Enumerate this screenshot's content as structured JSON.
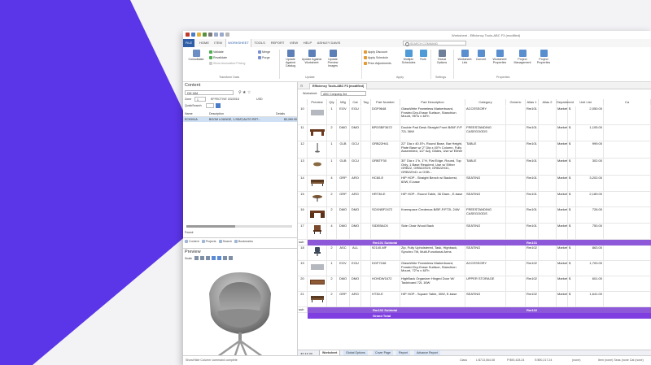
{
  "app": {
    "title": "Worksheet - Efficiency Tools-ABC F3 (modified)"
  },
  "menu": {
    "items": [
      "FILE",
      "HOME",
      "ITEM",
      "WORKSHEET",
      "TOOLS",
      "REPORT",
      "VIEW",
      "HELP",
      "ASHLEY DAVIS"
    ],
    "active": "WORKSHEET",
    "search_placeholder": "SEARCH COMMAND"
  },
  "ribbon": {
    "consolidate": "Consolidate",
    "validate": "Validate",
    "revalidate": "Revalidate",
    "show_associated": "Show Associated Pricing",
    "merge": "Merge",
    "purge": "Purge",
    "group_transform": "Transform Data",
    "update_catalog": "Update Against Catalog",
    "update_worksheet": "Update Against Worksheet",
    "update_preview": "Update Preview Images",
    "group_update": "Update",
    "apply_discount": "Apply Discount",
    "apply_schedule": "Apply Schedule",
    "price_adjustments": "Price Adjustments",
    "multiple_schedules": "Multiple Schedules",
    "rule": "Rule",
    "group_apply": "Apply",
    "global_options": "Global Options",
    "group_settings": "Settings",
    "worksheet_link": "Worksheet Link",
    "convert": "Convert",
    "worksheet_properties": "Worksheet Properties",
    "project_management": "Project Management",
    "project_properties": "Project Properties",
    "group_properties": "Properties"
  },
  "content_panel": {
    "title": "Content",
    "catalog_select": "DM 16M",
    "zone_label": "Zone",
    "zone_value": "1",
    "effective": "EFFECTIVE 3/3/2016",
    "currency": "USD",
    "quicksearch_label": "QuickSearch",
    "columns": [
      "Name",
      "Description",
      "Details"
    ],
    "row": {
      "name": "ECK991A",
      "description": "BOOM LOUNGE, 1-SEAT,AUTO RET...",
      "details": "$3,260.00"
    },
    "found_label": "Found:",
    "tabs": [
      "Content",
      "Projects",
      "Search",
      "Bookmarks"
    ]
  },
  "preview_panel": {
    "title": "Preview",
    "scale_label": "Scale"
  },
  "document": {
    "tab_title": "Efficiency Tools-ABC F3 (modified)",
    "worksheet_label": "Worksheet:",
    "worksheet_value": "ABC Company 3rd"
  },
  "grid": {
    "columns": [
      "Preview",
      "Qty",
      "Mfg",
      "Cat",
      "Tag",
      "Part Number",
      "Part Description",
      "Category",
      "Generic",
      "Alias 1",
      "Alias 2",
      "Department",
      "Unit List",
      "Ca"
    ],
    "rows": [
      {
        "num": "10",
        "qty": "1",
        "mfg": "EGV",
        "cat": "EGU",
        "part": "DGF9648",
        "desc": "GlassWrite Frameless Markerboard, Frosted Dry-Erase Surface, Stanchion Mount, 96\"w x 48\"h",
        "category": "ACCESSORY",
        "alias1": "Rm101",
        "dept": "Marketing",
        "currency": "$",
        "price": "2,050.00",
        "thumb": "board"
      },
      {
        "num": "11",
        "qty": "2",
        "mfg": "DMO",
        "cat": "DMO",
        "part": "BPDSBF3672",
        "desc": "Double Pad Desk Straight Front B/B/F-F/F 72L 36W",
        "category": "FREESTANDING CASEGOODS",
        "alias1": "Rm101",
        "dept": "Marketing",
        "currency": "$",
        "price": "1,105.00",
        "thumb": "desk"
      },
      {
        "num": "12",
        "qty": "1",
        "mfg": "GLB",
        "cat": "GCU",
        "part": "GRB22H41",
        "desc": "22\" Dia x 40.5\"h, Round Base, Bar Height, Plate Base w/ 2\" Dia x 40\"h Column, Fully Assembled, 1/2\" Adj. Glides, Use w/ Either",
        "category": "TABLE",
        "alias1": "Rm101",
        "dept": "Marketing",
        "currency": "$",
        "price": "999.00",
        "thumb": "column"
      },
      {
        "num": "13",
        "qty": "1",
        "mfg": "GLB",
        "cat": "GCU",
        "part": "GRBTF30",
        "desc": "30\" Dia x 1\"h, 1\"H, Flat Edge, Round, Top Only, 1 Base Required, Use w/ Either GRB22, GRB22H29, GRB22H31, GRB22H41 or GSB...",
        "category": "TABLE",
        "alias1": "Rm101",
        "dept": "Marketing",
        "currency": "$",
        "price": "302.00",
        "thumb": "top"
      },
      {
        "num": "14",
        "qty": "4",
        "mfg": "GRP",
        "cat": "ARO",
        "part": "HC60-E",
        "desc": "HIP HOP - Straight Bench w/ Backrest, 60W, E-base",
        "category": "SEATING",
        "alias1": "Rm101",
        "dept": "Marketing",
        "currency": "$",
        "price": "3,202.00",
        "thumb": "bench"
      },
      {
        "num": "15",
        "qty": "2",
        "mfg": "GRP",
        "cat": "ARO",
        "part": "HRT36-E",
        "desc": "HIP HOP - Round Table, 36 Diam., E-base",
        "category": "SEATING",
        "alias1": "Rm101",
        "dept": "Marketing",
        "currency": "$",
        "price": "2,189.00",
        "thumb": "table"
      },
      {
        "num": "16",
        "qty": "2",
        "mfg": "DMO",
        "cat": "DMO",
        "part": "SCKNBF2472",
        "desc": "Kneespace Credenza B/BF-F/F72L 24W",
        "category": "FREESTANDING CASEGOODS",
        "alias1": "Rm101",
        "dept": "Marketing",
        "currency": "$",
        "price": "726.00",
        "thumb": "credenza"
      },
      {
        "num": "17",
        "qty": "4",
        "mfg": "DMO",
        "cat": "DMO",
        "part": "SIDEBACK",
        "desc": "Side Chair Wood Back",
        "category": "SEATING",
        "alias1": "Rm101",
        "dept": "Marketing",
        "currency": "$",
        "price": "750.00",
        "thumb": "chair"
      },
      {
        "num": "18",
        "qty": "2",
        "mfg": "ASC",
        "cat": "ALL",
        "part": "92140-MF",
        "desc": "Zip, Fully Upholstered, Task, Highback, Synchro Tilt, Multi-Functional Arms",
        "category": "SEATING",
        "alias1": "Rm102",
        "dept": "Marketing",
        "currency": "$",
        "price": "863.00",
        "thumb": "task"
      },
      {
        "num": "19",
        "qty": "1",
        "mfg": "EGV",
        "cat": "EGU",
        "part": "DGF7248",
        "desc": "GlassWrite Frameless Markerboard, Frosted Dry-Erase Surface, Stanchion Mount, 72\"w x 48\"h",
        "category": "ACCESSORY",
        "alias1": "Rm102",
        "dept": "Marketing",
        "currency": "$",
        "price": "1,700.00",
        "thumb": "board"
      },
      {
        "num": "20",
        "qty": "2",
        "mfg": "DMO",
        "cat": "DMO",
        "part": "HOHDW1672",
        "desc": "HighBack Organizer Hinged Door W/ Tackboard 72L 16W",
        "category": "UPPER STORAGE",
        "alias1": "Rm102",
        "dept": "Marketing",
        "currency": "$",
        "price": "601.00",
        "thumb": "organizer"
      },
      {
        "num": "21",
        "qty": "2",
        "mfg": "GRP",
        "cat": "ARO",
        "part": "HT30-E",
        "desc": "HIP HOP - Square Table, 30W, E-base",
        "category": "SEATING",
        "alias1": "Rm102",
        "dept": "Marketing",
        "currency": "$",
        "price": "1,641.00",
        "thumb": "bench"
      }
    ],
    "subtotal_rm101": "Rm101 Subtotal",
    "subtotal_rm101_alias": "Rm101",
    "subtotal_rm102": "Rm102 Subtotal",
    "subtotal_rm102_alias": "Rm102",
    "grand_total": "Grand Total",
    "sub_label": "sub"
  },
  "sheet_tabs": [
    "Worksheet",
    "Global Options",
    "Cover Page",
    "Report",
    "Advance Report"
  ],
  "status": {
    "left": "Show/Hide Column' command complete",
    "mode": "Class",
    "l": "L:$713,064.08",
    "p": "P:$90,428.24",
    "s": "S:$90,217.24",
    "none": "(none)",
    "right": "Item (none) Seas (none Cat (none)"
  },
  "colors": {
    "purple": "#5b35e8",
    "subtotal": "#8e59d8",
    "grand_total": "#7f3fe0",
    "file_tab": "#2e5ea8"
  }
}
